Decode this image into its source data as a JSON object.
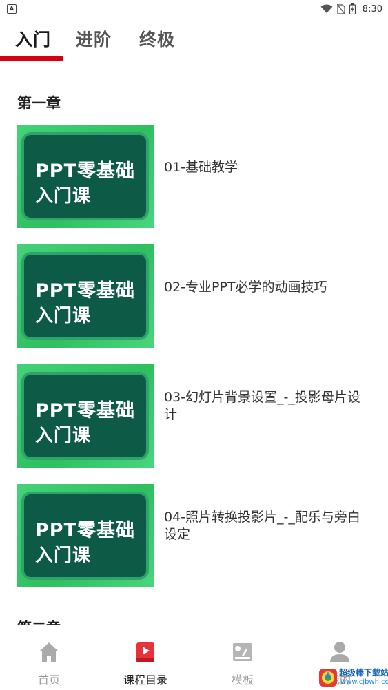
{
  "status_bar": {
    "time": "8:30",
    "app_icon_letter": "A",
    "icons": [
      "wifi-icon",
      "no-sim-icon",
      "battery-icon"
    ]
  },
  "tabs": [
    {
      "label": "入门",
      "active": true
    },
    {
      "label": "进阶",
      "active": false
    },
    {
      "label": "终极",
      "active": false
    }
  ],
  "accent_color": "#d7000f",
  "chapters": [
    {
      "title": "第一章",
      "lessons": [
        {
          "title": "01-基础教学",
          "thumb_line1": "PPT零基础",
          "thumb_line2": "入门课"
        },
        {
          "title": "02-专业PPT必学的动画技巧",
          "thumb_line1": "PPT零基础",
          "thumb_line2": "入门课"
        },
        {
          "title": "03-幻灯片背景设置_-_投影母片设计",
          "thumb_line1": "PPT零基础",
          "thumb_line2": "入门课"
        },
        {
          "title": "04-照片转换投影片_-_配乐与旁白设定",
          "thumb_line1": "PPT零基础",
          "thumb_line2": "入门课"
        }
      ]
    },
    {
      "title": "第二章",
      "lessons": []
    }
  ],
  "bottom_nav": [
    {
      "label": "首页",
      "icon": "home-icon",
      "active": false
    },
    {
      "label": "课程目录",
      "icon": "play-icon",
      "active": true
    },
    {
      "label": "模板",
      "icon": "template-icon",
      "active": false
    },
    {
      "label": "我的",
      "icon": "user-icon",
      "active": false
    }
  ],
  "watermark": {
    "text": "超级棒下载站",
    "url": "www.cjbwh.com"
  }
}
